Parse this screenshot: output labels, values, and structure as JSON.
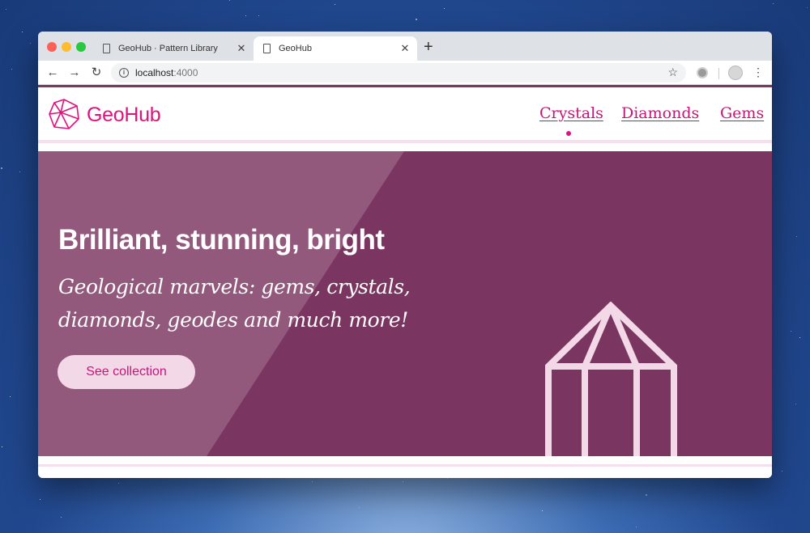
{
  "browser": {
    "tabs": [
      {
        "title": "GeoHub · Pattern Library",
        "close": "✕"
      },
      {
        "title": "GeoHub",
        "close": "✕"
      }
    ],
    "new_tab": "+",
    "back": "←",
    "forward": "→",
    "reload": "↻",
    "url_host": "localhost",
    "url_port": ":4000",
    "bookmark": "☆",
    "menu": "⋮"
  },
  "site": {
    "brand": "GeoHub",
    "nav": [
      "Crystals",
      "Diamonds",
      "Gems"
    ],
    "active_nav": "Crystals",
    "hero": {
      "title": "Brilliant, stunning, bright",
      "subtitle": "Geological marvels: gems, crystals, diamonds, geodes and much more!",
      "button": "See collection"
    }
  },
  "colors": {
    "brand": "#e0127e",
    "hero_bg": "#7b3561",
    "button_bg": "#f3d9e8",
    "accent_rule": "#f5dfec"
  },
  "icons": [
    "doc-icon",
    "back-arrow-icon",
    "forward-arrow-icon",
    "reload-icon",
    "info-icon",
    "star-icon",
    "extension-icon",
    "avatar-icon",
    "menu-icon",
    "geohub-logo-icon",
    "crystal-illustration"
  ]
}
